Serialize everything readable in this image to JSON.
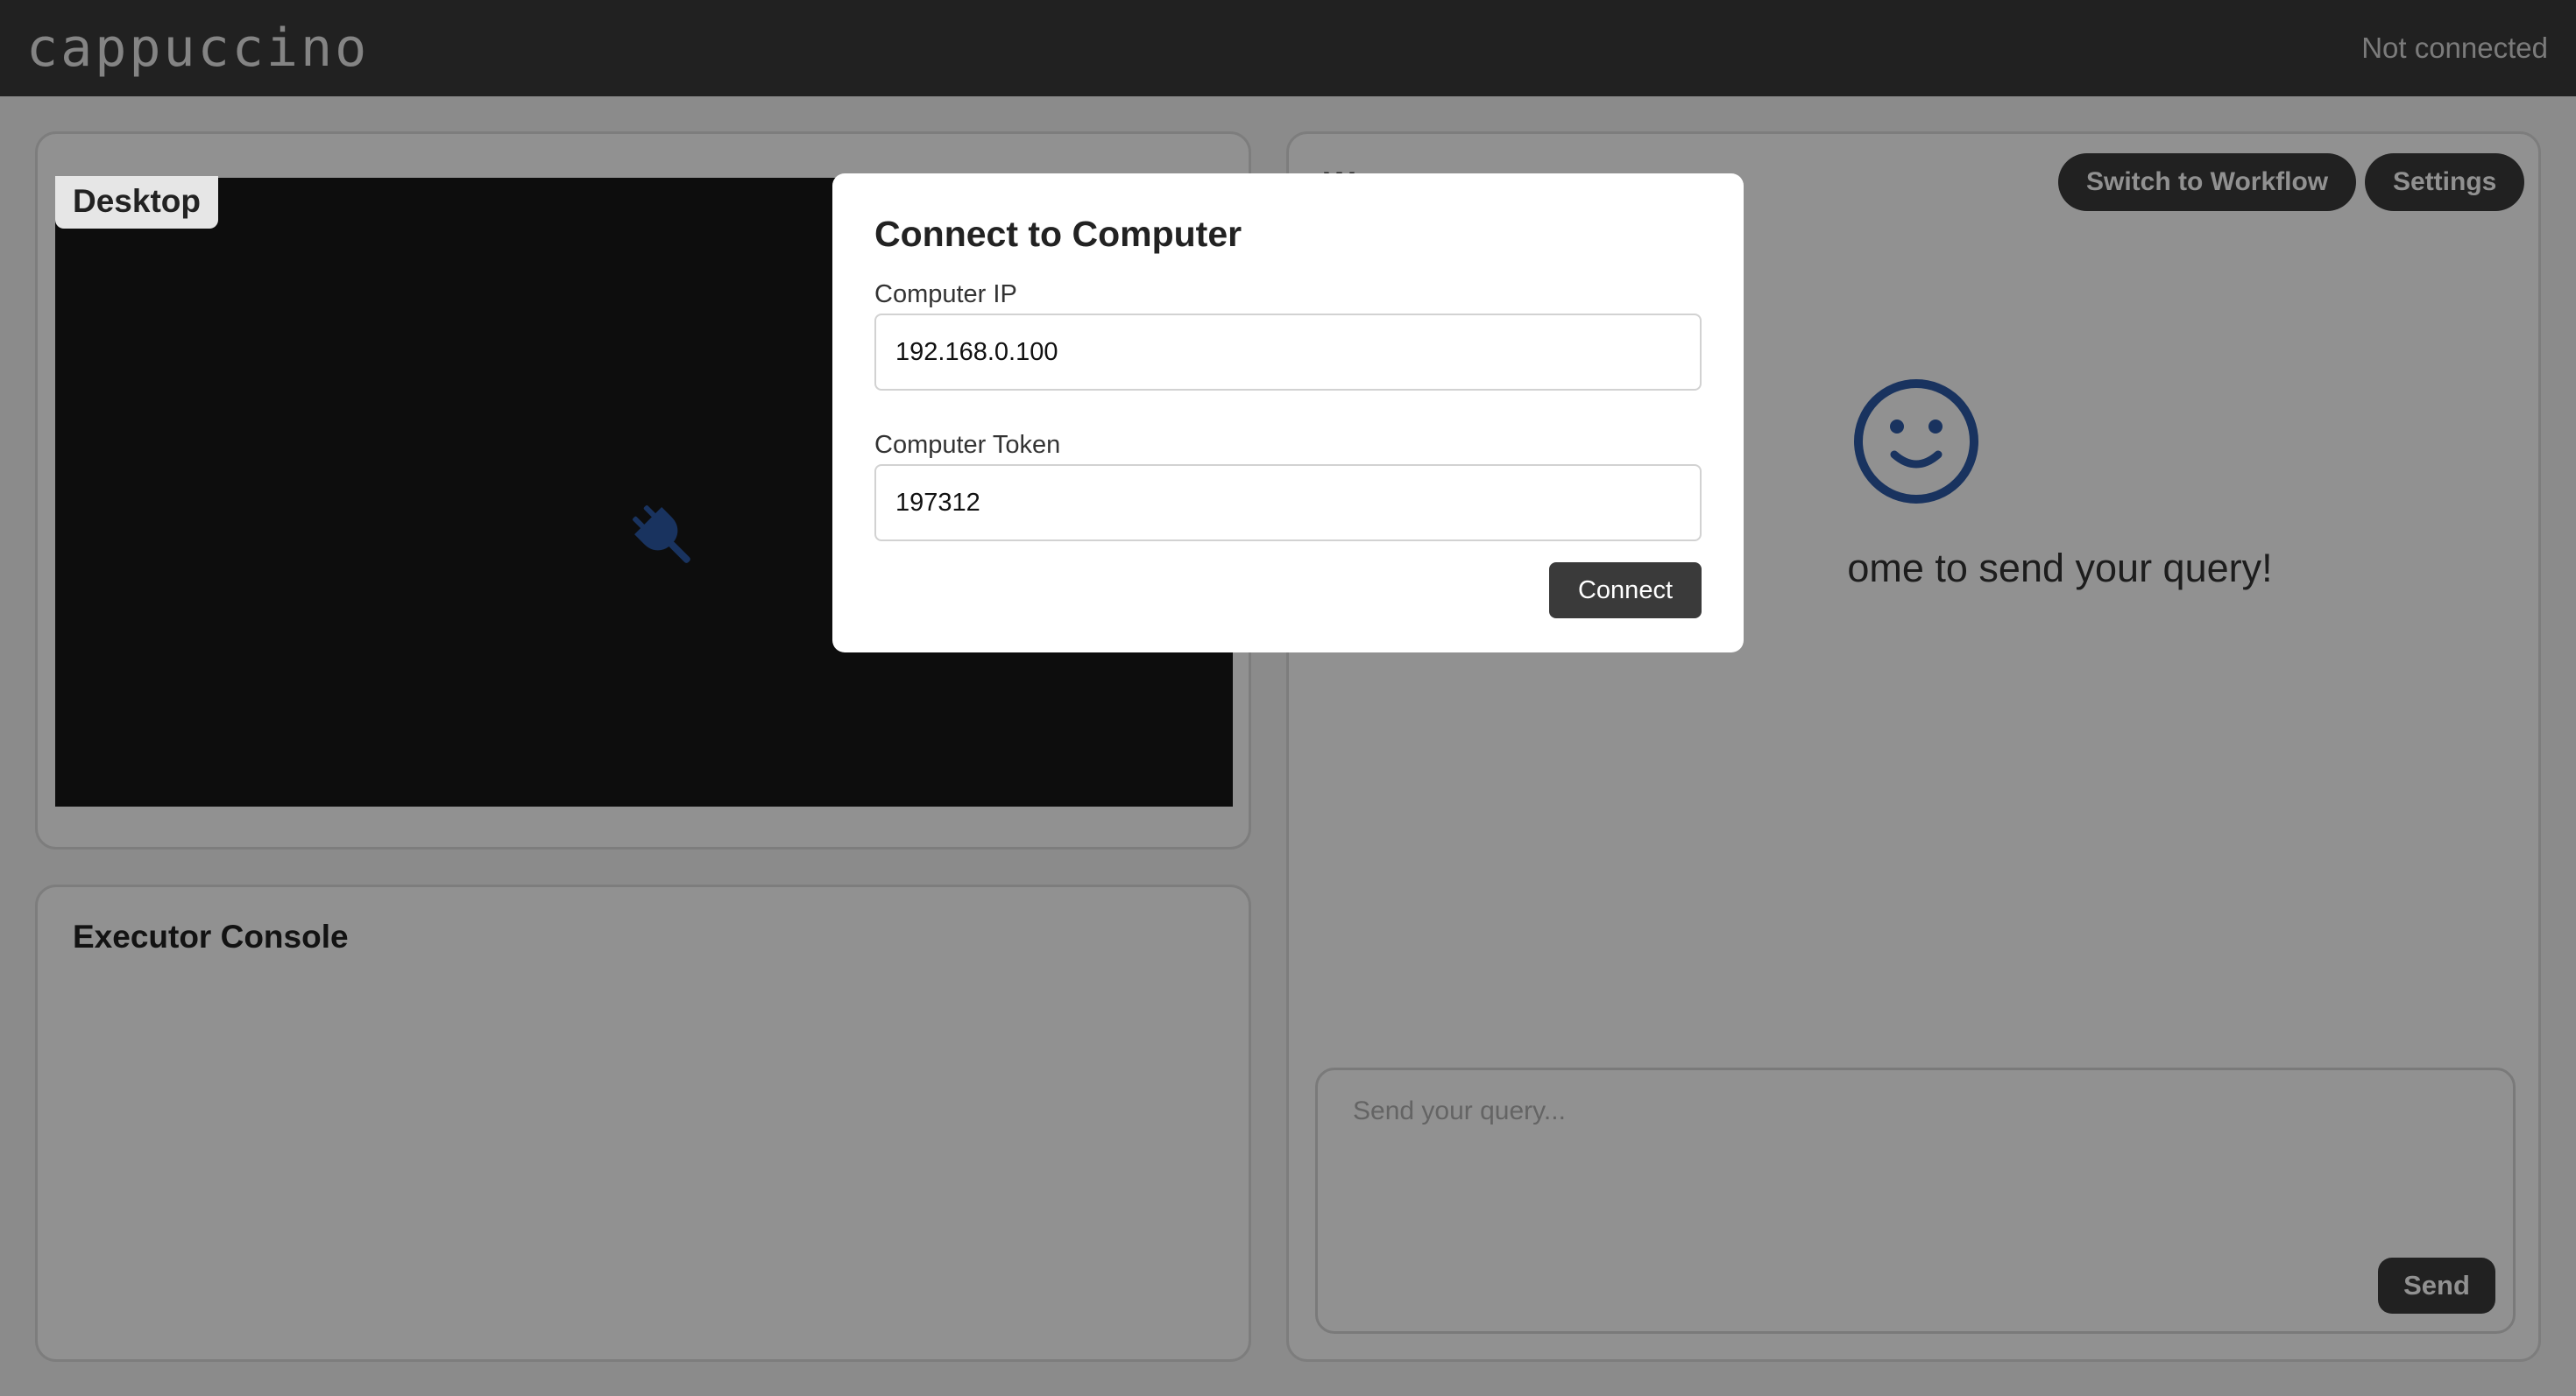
{
  "header": {
    "logo": "cappuccino",
    "status": "Not connected"
  },
  "desktop": {
    "label": "Desktop",
    "icon": "plug-icon",
    "screen_color": "#181818"
  },
  "console": {
    "title": "Executor Console"
  },
  "chat": {
    "partial_title": "W",
    "buttons": {
      "workflow": "Switch to Workflow",
      "settings": "Settings"
    },
    "welcome_icon": "smile-icon",
    "welcome_text": "ome to send your query!",
    "query_placeholder": "Send your query...",
    "send_label": "Send"
  },
  "modal": {
    "title": "Connect to Computer",
    "ip_label": "Computer IP",
    "ip_value": "192.168.0.100",
    "token_label": "Computer Token",
    "token_value": "197312",
    "connect_label": "Connect"
  },
  "colors": {
    "accent_blue": "#2c5aa8",
    "header_bg": "#3b3b3b",
    "button_dark": "#3a3a3a"
  }
}
